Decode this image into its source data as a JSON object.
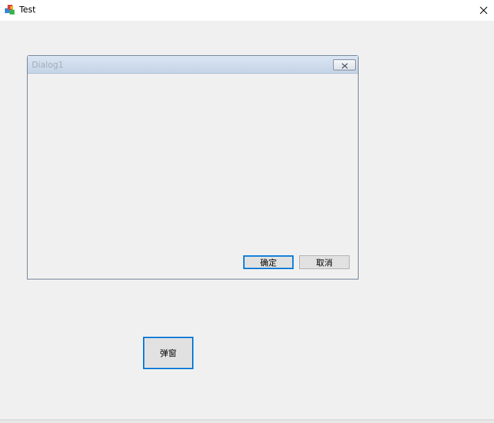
{
  "window": {
    "title": "Test",
    "icon": "app-cubes-icon"
  },
  "dialog": {
    "title": "Dialog1",
    "ok_label": "确定",
    "cancel_label": "取消"
  },
  "main": {
    "popup_button_label": "弹窗"
  },
  "colors": {
    "focus_border": "#0078d7",
    "button_face": "#e1e1e1",
    "background": "#f0f0f0"
  }
}
